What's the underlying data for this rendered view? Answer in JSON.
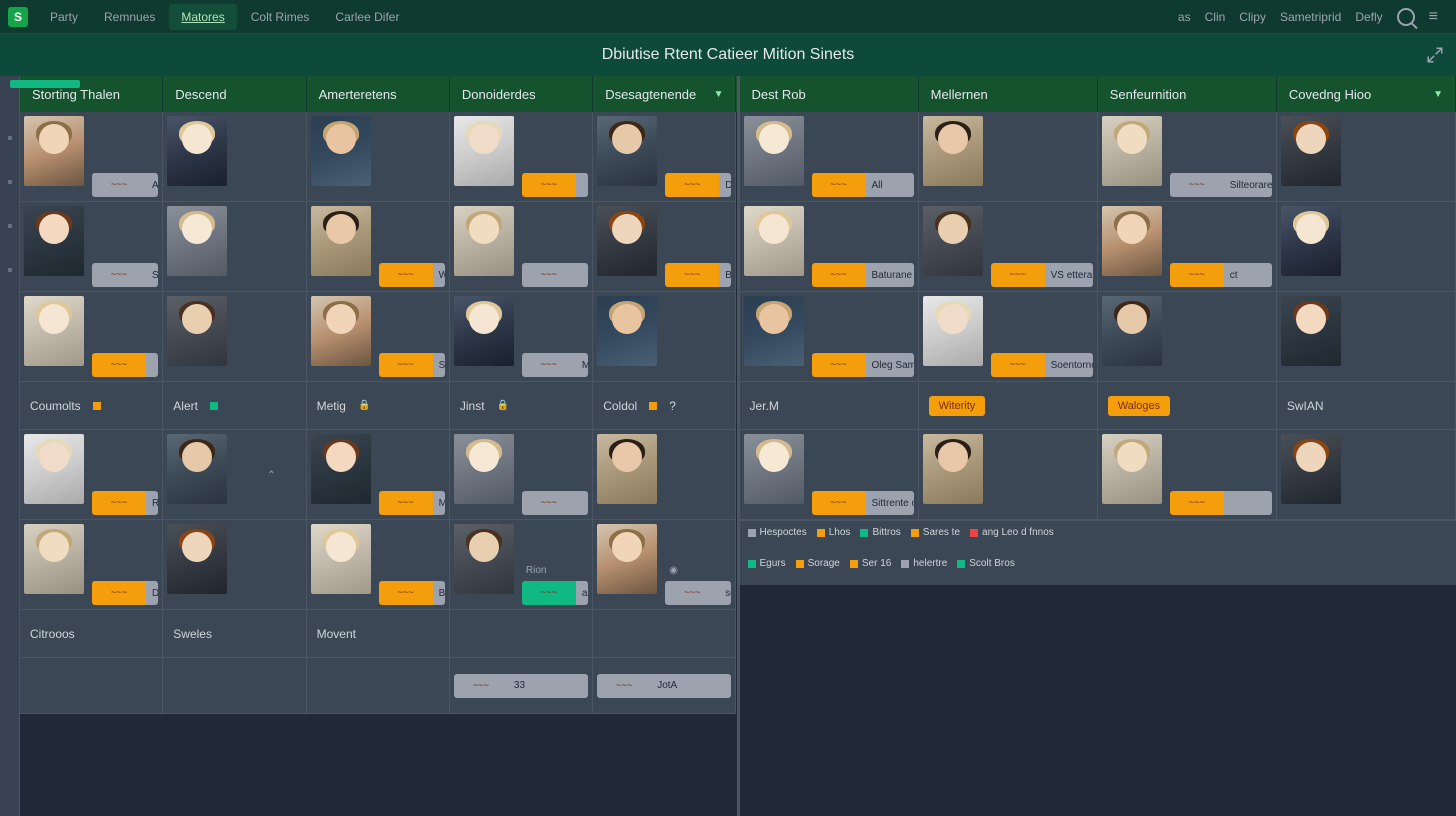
{
  "topnav": {
    "logo": "S",
    "items": [
      "Party",
      "Remnues",
      "Matores",
      "Colt Rimes",
      "Carlee Difer"
    ],
    "active_index": 2,
    "right": [
      "as",
      "Clin",
      "Clipy",
      "Sametriprid",
      "Defly"
    ]
  },
  "title": "Dbiutise Rtent Catieer Mition Sinets",
  "left": {
    "headers": [
      "Storting Thalen",
      "Descend",
      "Amerteretens",
      "Donoiderdes",
      "Dsesagtenende"
    ],
    "header_caret": 4,
    "rows": [
      [
        {
          "tag": "gray",
          "label": "Annettit"
        },
        {
          "tag": null
        },
        {
          "tag": null
        },
        {
          "tag": "orange",
          "label": ""
        },
        {
          "tag": "orange",
          "label": "Destattannt fit"
        }
      ],
      [
        {
          "tag": "gray",
          "label": "Setrennte ata"
        },
        {
          "tag": null
        },
        {
          "tag": "orange",
          "label": "Wio Cente"
        },
        {
          "tag": "gray",
          "label": ""
        },
        {
          "tag": "orange",
          "label": "Bunnrnt iav"
        }
      ],
      [
        {
          "tag": "orange",
          "label": ""
        },
        {
          "tag": null
        },
        {
          "tag": "orange",
          "label": "Sererne not"
        },
        {
          "tag": "gray",
          "label": "Moroenata aw"
        },
        {
          "tag": null
        }
      ]
    ],
    "names": [
      {
        "n": "Coumolts",
        "c": "o"
      },
      {
        "n": "Alert",
        "c": "g"
      },
      {
        "n": "Metig",
        "c": null,
        "lock": true
      },
      {
        "n": "Jinst",
        "c": null,
        "lock": true
      },
      {
        "n": "Coldol",
        "c": "o",
        "q": true
      }
    ],
    "rows2": [
      [
        {
          "tag": "orange",
          "label": "Rrtroste ote"
        },
        {
          "tag": null,
          "up": true
        },
        {
          "tag": "orange",
          "label": "Minit Rolans"
        },
        {
          "tag": "gray",
          "label": ""
        },
        {
          "tag": null
        }
      ],
      [
        {
          "tag": "orange",
          "label": "Dresseer aw"
        },
        {
          "tag": null
        },
        {
          "tag": "orange",
          "label": "Brune soure"
        },
        {
          "tag": "green",
          "label": "antnenner",
          "sub": "Rion"
        },
        {
          "tag": "gray",
          "label": "selesmt",
          "sub_icon": true
        }
      ]
    ],
    "names2": [
      {
        "n": "Citrooos"
      },
      {
        "n": "Sweles"
      },
      {
        "n": "Movent"
      },
      {
        "n": ""
      },
      {
        "n": ""
      }
    ],
    "bottom": [
      {
        "empty": true
      },
      {
        "empty": true
      },
      {
        "empty": true
      },
      {
        "tag": "gray",
        "label": "33"
      },
      {
        "tag": "gray",
        "label": "JotA"
      }
    ]
  },
  "right": {
    "headers": [
      "Dest Rob",
      "Mellernen",
      "Senfeurnition",
      "Covedng Hioo"
    ],
    "header_caret": 3,
    "rows": [
      [
        {
          "tag": "orange",
          "label": "All"
        },
        {
          "tag": null
        },
        {
          "tag": "gray",
          "label": "Silteorare ow"
        },
        {
          "tag": null
        }
      ],
      [
        {
          "tag": "orange",
          "label": "Baturane taet"
        },
        {
          "tag": "orange",
          "label": "VS etterases"
        },
        {
          "tag": "orange",
          "label": "ct"
        },
        {
          "tag": null
        }
      ],
      [
        {
          "tag": "orange",
          "label": "Oleg Samins"
        },
        {
          "tag": "orange",
          "label": "Soentornot ott"
        },
        {
          "tag": null
        },
        {
          "tag": null
        }
      ]
    ],
    "names": [
      {
        "n": "Jer.M"
      },
      {
        "n": "Witerity",
        "pill": true
      },
      {
        "n": "Waloges",
        "pill": true
      },
      {
        "n": "SwIAN"
      }
    ],
    "rows2": [
      [
        {
          "tag": "orange",
          "label": "Sittrente ote"
        },
        {
          "tag": null
        },
        {
          "tag": "orange",
          "label": ""
        },
        {
          "tag": null
        }
      ]
    ],
    "legend1": [
      {
        "l": "Hespoctes",
        "c": "#9ca3af"
      },
      {
        "l": "Lhos",
        "c": "#f59e0b"
      },
      {
        "l": "Bittros",
        "c": "#10b981"
      },
      {
        "l": "Sares te",
        "c": "#f59e0b"
      },
      {
        "l": "ang Leo d fnnos",
        "c": "#ef4444"
      }
    ],
    "legend2": [
      {
        "l": "Egurs",
        "c": "#10b981"
      },
      {
        "l": "Sorage",
        "c": "#f59e0b"
      },
      {
        "l": "Ser 16",
        "c": "#f59e0b"
      },
      {
        "l": "helertre",
        "c": "#9ca3af"
      },
      {
        "l": "Scolt Bros",
        "c": "#10b981"
      }
    ]
  },
  "palettes": [
    {
      "a1": "#d4c5b0",
      "a2": "#b89070",
      "a3": "#6b5540",
      "hair": "#8b6f47",
      "skin": "#f0d5b8"
    },
    {
      "a1": "#4a5568",
      "a2": "#2d3748",
      "a3": "#1a202c",
      "hair": "#dec89a",
      "skin": "#f5e6d3"
    },
    {
      "a1": "#2c3e50",
      "a2": "#34495e",
      "a3": "#4a6075",
      "hair": "#c4a574",
      "skin": "#e8c4a0"
    },
    {
      "a1": "#e8e8e8",
      "a2": "#cccccc",
      "a3": "#aaaaaa",
      "hair": "#e6d9b8",
      "skin": "#f0dcc8"
    },
    {
      "a1": "#5a6876",
      "a2": "#3d4a57",
      "a3": "#2a3440",
      "hair": "#3d2817",
      "skin": "#e5c9a8"
    },
    {
      "a1": "#3a4550",
      "a2": "#2c3640",
      "a3": "#1e2830",
      "hair": "#6b3a1e",
      "skin": "#f2d9c0"
    },
    {
      "a1": "#8a9099",
      "a2": "#6e7580",
      "a3": "#525a66",
      "hair": "#d4bb8e",
      "skin": "#f5e8d5"
    },
    {
      "a1": "#c8b8a0",
      "a2": "#a89878",
      "a3": "#8a7a5c",
      "hair": "#2a2015",
      "skin": "#e8c8a8"
    },
    {
      "a1": "#d8d0c0",
      "a2": "#b8b0a0",
      "a3": "#989080",
      "hair": "#c0a878",
      "skin": "#f0dcc0"
    },
    {
      "a1": "#4a5058",
      "a2": "#353a42",
      "a3": "#20262e",
      "hair": "#8b4513",
      "skin": "#edd6bc"
    },
    {
      "a1": "#e0d8c8",
      "a2": "#c0b8a8",
      "a3": "#a09888",
      "hair": "#dec89a",
      "skin": "#f5e6d3"
    },
    {
      "a1": "#5a6068",
      "a2": "#454a52",
      "a3": "#30353e",
      "hair": "#4a3020",
      "skin": "#e8cfb0"
    }
  ]
}
